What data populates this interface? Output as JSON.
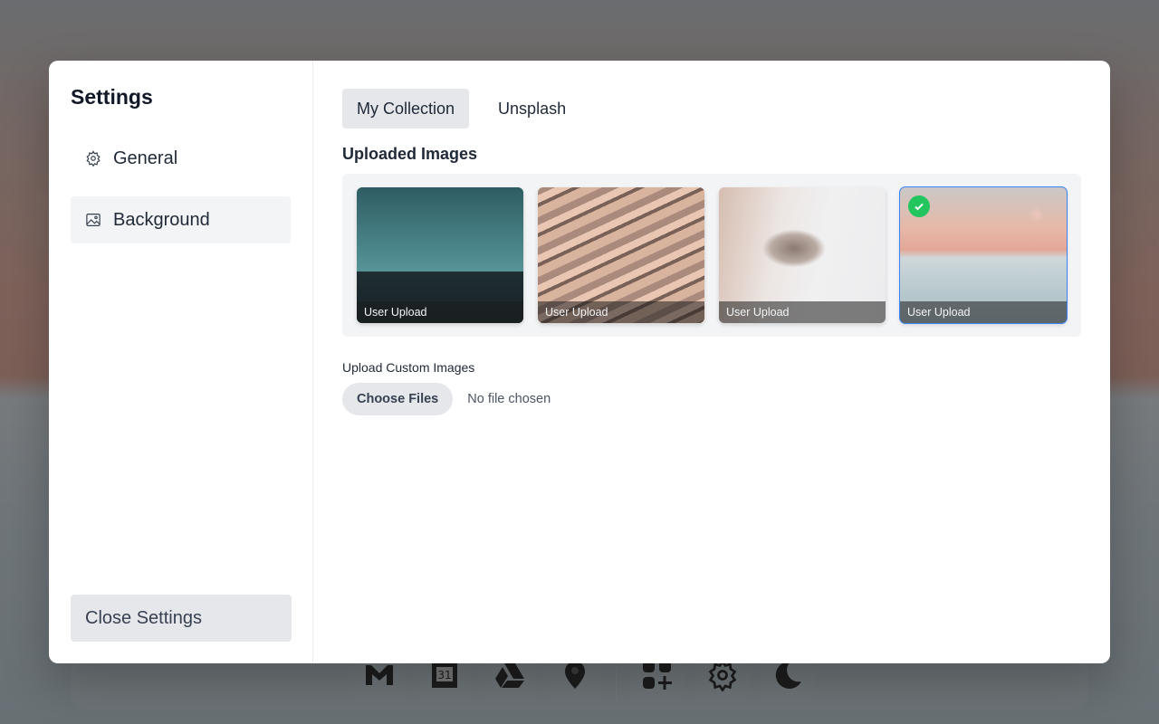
{
  "sidebar": {
    "title": "Settings",
    "items": [
      {
        "label": "General",
        "icon": "gear-icon",
        "active": false
      },
      {
        "label": "Background",
        "icon": "image-icon",
        "active": true
      }
    ],
    "close_label": "Close Settings"
  },
  "main": {
    "tabs": [
      {
        "label": "My Collection",
        "active": true
      },
      {
        "label": "Unsplash",
        "active": false
      }
    ],
    "section_title": "Uploaded Images",
    "images": [
      {
        "caption": "User Upload",
        "subject": "mountain",
        "selected": false
      },
      {
        "caption": "User Upload",
        "subject": "facade",
        "selected": false
      },
      {
        "caption": "User Upload",
        "subject": "building",
        "selected": false
      },
      {
        "caption": "User Upload",
        "subject": "desert",
        "selected": true
      }
    ],
    "upload": {
      "label": "Upload Custom Images",
      "button_label": "Choose Files",
      "status": "No file chosen"
    }
  },
  "dock": {
    "apps": [
      "gmail-icon",
      "calendar-icon",
      "drive-icon",
      "maps-icon",
      "add-app-icon",
      "settings-icon",
      "dark-mode-icon"
    ],
    "calendar_day": "31"
  },
  "colors": {
    "accent": "#3b82f6",
    "success": "#22c55e",
    "active_bg": "#e5e7eb"
  }
}
